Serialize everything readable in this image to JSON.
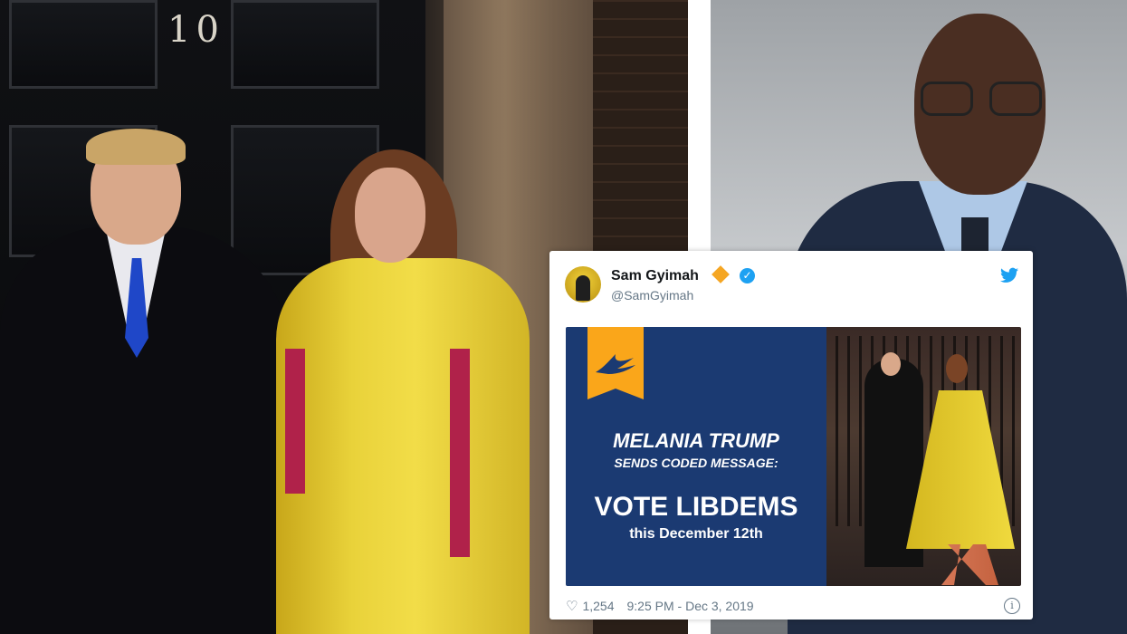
{
  "left_photo": {
    "door_number": "10"
  },
  "tweet": {
    "author_name": "Sam Gyimah",
    "author_handle": "@SamGyimah",
    "media": {
      "headline_1": "MELANIA TRUMP",
      "headline_2": "SENDS CODED MESSAGE:",
      "headline_3": "VOTE LIBDEMS",
      "headline_4": "this December 12th"
    },
    "likes": "1,254",
    "timestamp": "9:25 PM - Dec 3, 2019",
    "icons": {
      "like": "heart-icon",
      "info": "info-icon",
      "platform": "twitter-bird-icon",
      "verified": "verified-badge-icon",
      "party": "orange-diamond-icon"
    },
    "colors": {
      "libdem_orange": "#faa61a",
      "libdem_navy": "#1b3a72",
      "twitter_blue": "#1da1f2"
    }
  }
}
